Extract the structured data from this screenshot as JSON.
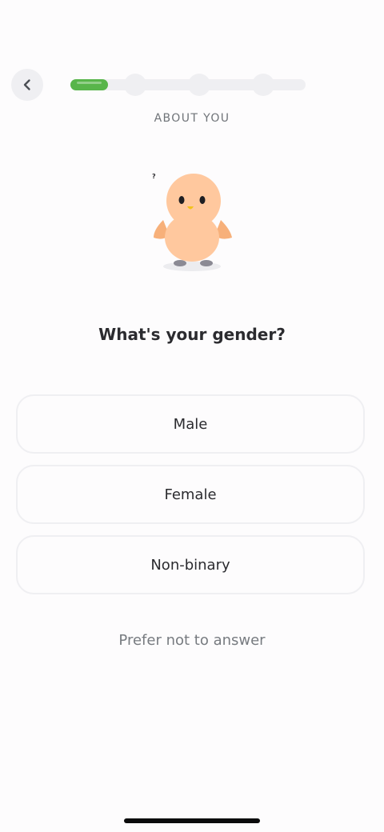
{
  "header": {
    "back_icon": "chevron-left-icon",
    "progress": {
      "fraction": 0.16,
      "steps": 4,
      "current_step": 1,
      "accent_color": "#58b54a"
    },
    "section_label": "ABOUT YOU"
  },
  "illustration": {
    "name": "thinking-bird-mascot",
    "thought_mark": "?"
  },
  "main": {
    "question": "What's your gender?",
    "options": [
      {
        "label": "Male"
      },
      {
        "label": "Female"
      },
      {
        "label": "Non-binary"
      }
    ],
    "skip_label": "Prefer not to answer"
  }
}
